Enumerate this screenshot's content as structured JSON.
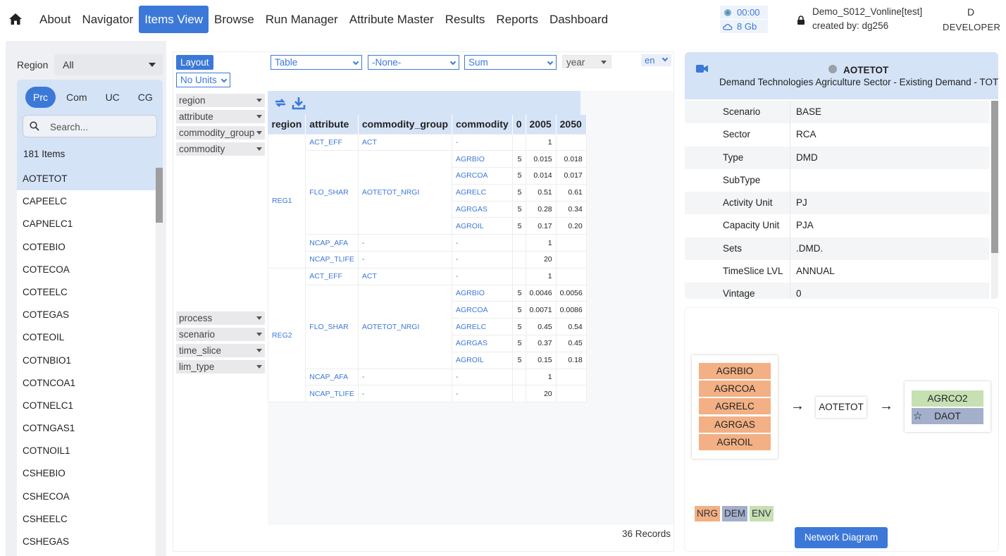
{
  "nav": {
    "items": [
      "About",
      "Navigator",
      "Items View",
      "Browse",
      "Run Manager",
      "Attribute Master",
      "Results",
      "Reports",
      "Dashboard"
    ],
    "active": "Items View"
  },
  "system": {
    "time": "00:00",
    "memory": "8 Gb"
  },
  "project": {
    "name": "Demo_S012_Vonline[test]",
    "created_by": "created by: dg256"
  },
  "user": {
    "avatar": "D",
    "role": "DEVELOPER"
  },
  "left": {
    "region_label": "Region",
    "region_value": "All",
    "tabs": [
      "Prc",
      "Com",
      "UC",
      "CG"
    ],
    "active_tab": "Prc",
    "search_placeholder": "Search...",
    "count": "181 Items",
    "items": [
      "AOTETOT",
      "CAPEELC",
      "CAPNELC1",
      "COTEBIO",
      "COTECOA",
      "COTEELC",
      "COTEGAS",
      "COTEOIL",
      "COTNBIO1",
      "COTNCOA1",
      "COTNELC1",
      "COTNGAS1",
      "COTNOIL1",
      "CSHEBIO",
      "CSHECOA",
      "CSHEELC",
      "CSHEGAS"
    ],
    "selected": "AOTETOT"
  },
  "center": {
    "layout_label": "Layout",
    "units_label": "No Units",
    "view_select": "Table",
    "none_select": "-None-",
    "agg_select": "Sum",
    "year_select": "year",
    "lang": "en",
    "row_fields": [
      "region",
      "attribute",
      "commodity_group",
      "commodity"
    ],
    "filter_fields": [
      "process",
      "scenario",
      "time_slice",
      "lim_type"
    ],
    "columns": [
      "region",
      "attribute",
      "commodity_group",
      "commodity",
      "0",
      "2005",
      "2050"
    ],
    "rows": [
      [
        "REG1",
        "ACT_EFF",
        "ACT",
        "-",
        "",
        "1",
        ""
      ],
      [
        "REG1",
        "FLO_SHAR",
        "AOTETOT_NRGI",
        "AGRBIO",
        "5",
        "0.015",
        "0.018"
      ],
      [
        "REG1",
        "FLO_SHAR",
        "AOTETOT_NRGI",
        "AGRCOA",
        "5",
        "0.014",
        "0.017"
      ],
      [
        "REG1",
        "FLO_SHAR",
        "AOTETOT_NRGI",
        "AGRELC",
        "5",
        "0.51",
        "0.61"
      ],
      [
        "REG1",
        "FLO_SHAR",
        "AOTETOT_NRGI",
        "AGRGAS",
        "5",
        "0.28",
        "0.34"
      ],
      [
        "REG1",
        "FLO_SHAR",
        "AOTETOT_NRGI",
        "AGROIL",
        "5",
        "0.17",
        "0.20"
      ],
      [
        "REG1",
        "NCAP_AFA",
        "-",
        "-",
        "",
        "1",
        ""
      ],
      [
        "REG1",
        "NCAP_TLIFE",
        "-",
        "-",
        "",
        "20",
        ""
      ],
      [
        "REG2",
        "ACT_EFF",
        "ACT",
        "-",
        "",
        "1",
        ""
      ],
      [
        "REG2",
        "FLO_SHAR",
        "AOTETOT_NRGI",
        "AGRBIO",
        "5",
        "0.0046",
        "0.0056"
      ],
      [
        "REG2",
        "FLO_SHAR",
        "AOTETOT_NRGI",
        "AGRCOA",
        "5",
        "0.0071",
        "0.0086"
      ],
      [
        "REG2",
        "FLO_SHAR",
        "AOTETOT_NRGI",
        "AGRELC",
        "5",
        "0.45",
        "0.54"
      ],
      [
        "REG2",
        "FLO_SHAR",
        "AOTETOT_NRGI",
        "AGRGAS",
        "5",
        "0.37",
        "0.45"
      ],
      [
        "REG2",
        "FLO_SHAR",
        "AOTETOT_NRGI",
        "AGROIL",
        "5",
        "0.15",
        "0.18"
      ],
      [
        "REG2",
        "NCAP_AFA",
        "-",
        "-",
        "",
        "1",
        ""
      ],
      [
        "REG2",
        "NCAP_TLIFE",
        "-",
        "-",
        "",
        "20",
        ""
      ]
    ],
    "records": "36 Records"
  },
  "details": {
    "process": "AOTETOT",
    "description": "Demand Technologies Agriculture Sector - Existing Demand - TOT",
    "props": [
      {
        "k": "Scenario",
        "v": "BASE"
      },
      {
        "k": "Sector",
        "v": "RCA"
      },
      {
        "k": "Type",
        "v": "DMD"
      },
      {
        "k": "SubType",
        "v": ""
      },
      {
        "k": "Activity Unit",
        "v": "PJ"
      },
      {
        "k": "Capacity Unit",
        "v": "PJA"
      },
      {
        "k": "Sets",
        "v": ".DMD."
      },
      {
        "k": "TimeSlice LVL",
        "v": "ANNUAL"
      },
      {
        "k": "Vintage",
        "v": "0"
      }
    ]
  },
  "diagram": {
    "inputs": [
      "AGRBIO",
      "AGRCOA",
      "AGRELC",
      "AGRGAS",
      "AGROIL"
    ],
    "process": "AOTETOT",
    "outputs": [
      {
        "name": "AGRCO2",
        "kind": "ENV"
      },
      {
        "name": "DAOT",
        "kind": "DEM"
      }
    ],
    "legend": [
      "NRG",
      "DEM",
      "ENV"
    ],
    "colors": {
      "NRG": "#f2b084",
      "DEM": "#a3afcb",
      "ENV": "#c6e0b4"
    },
    "button": "Network Diagram"
  }
}
